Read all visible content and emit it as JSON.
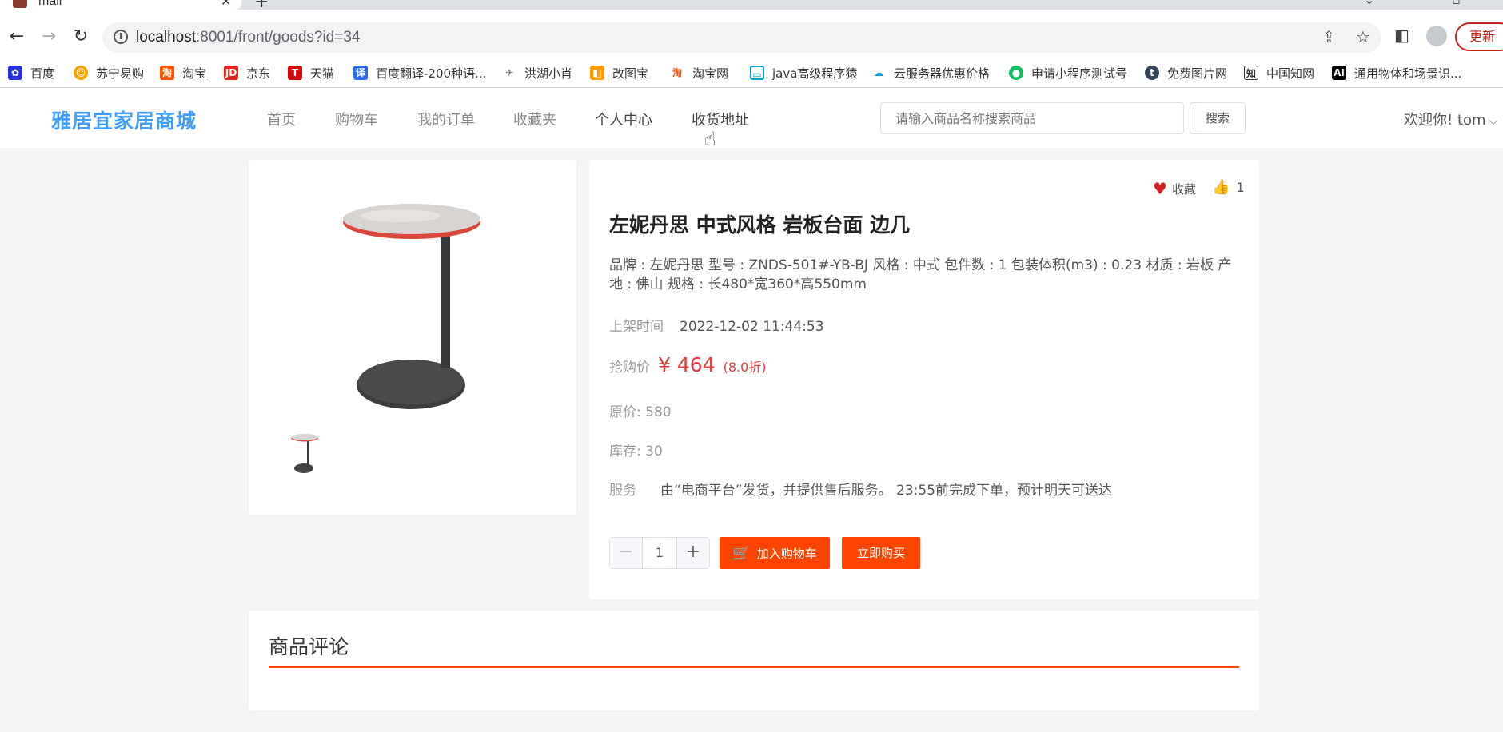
{
  "browser": {
    "tab_title": "mall",
    "url_host": "localhost",
    "url_path": ":8001/front/goods?id=34",
    "update_label": "更新",
    "bookmarks": [
      {
        "label": "百度",
        "color": "#2932e1"
      },
      {
        "label": "苏宁易购",
        "color": "#f7a500"
      },
      {
        "label": "淘宝",
        "color": "#ff5000"
      },
      {
        "label": "京东",
        "color": "#e1251b"
      },
      {
        "label": "天猫",
        "color": "#d40a0a"
      },
      {
        "label": "百度翻译-200种语...",
        "color": "#2b6af3"
      },
      {
        "label": "洪湖小肖",
        "color": "#777777"
      },
      {
        "label": "改图宝",
        "color": "#ff9b00"
      },
      {
        "label": "淘宝网",
        "color": "#ff5000"
      },
      {
        "label": "java高级程序猿",
        "color": "#00a1d6"
      },
      {
        "label": "云服务器优惠价格",
        "color": "#00a3e8"
      },
      {
        "label": "申请小程序测试号",
        "color": "#07c160"
      },
      {
        "label": "免费图片网",
        "color": "#35465c"
      },
      {
        "label": "中国知网",
        "color": "#555555"
      },
      {
        "label": "通用物体和场景识...",
        "color": "#000000"
      }
    ]
  },
  "header": {
    "logo": "雅居宜家居商城",
    "menu": [
      "首页",
      "购物车",
      "我的订单",
      "收藏夹",
      "个人中心",
      "收货地址"
    ],
    "search_placeholder": "请输入商品名称搜索商品",
    "search_button": "搜索",
    "welcome": "欢迎你!",
    "username": "tom"
  },
  "product": {
    "fav_label": "收藏",
    "like_count": "1",
    "title": "左妮丹思 中式风格 岩板台面 边几",
    "description": "品牌 : 左妮丹思 型号 : ZNDS-501#-YB-BJ 风格 : 中式 包件数 : 1 包装体积(m3) : 0.23 材质 : 岩板 产地 : 佛山 规格 : 长480*宽360*高550mm",
    "listed_label": "上架时间",
    "listed_value": "2022-12-02 11:44:53",
    "price_label": "抢购价",
    "price_value": "¥ 464",
    "discount": "(8.0折)",
    "original_label": "原价:",
    "original_value": "580",
    "stock_label": "库存:",
    "stock_value": "30",
    "service_label": "服务",
    "service_value": "由“电商平台”发货，并提供售后服务。 23:55前完成下单，预计明天可送达",
    "quantity": "1",
    "add_cart_label": "加入购物车",
    "buy_now_label": "立即购买"
  },
  "reviews": {
    "title": "商品评论"
  },
  "colors": {
    "brand_blue": "#409eff",
    "accent_orange": "#ff4400",
    "price_red": "#e4393c"
  }
}
